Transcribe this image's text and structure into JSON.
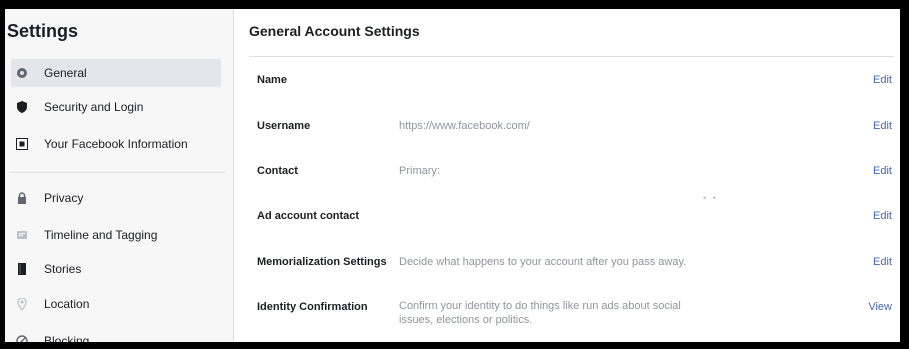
{
  "sidebar": {
    "title": "Settings",
    "items": [
      {
        "label": "General",
        "icon": "gear-icon"
      },
      {
        "label": "Security and Login",
        "icon": "shield-icon"
      },
      {
        "label": "Your Facebook Information",
        "icon": "facebook-icon"
      },
      {
        "label": "Privacy",
        "icon": "lock-icon"
      },
      {
        "label": "Timeline and Tagging",
        "icon": "tag-icon"
      },
      {
        "label": "Stories",
        "icon": "book-icon"
      },
      {
        "label": "Location",
        "icon": "location-pin-icon"
      },
      {
        "label": "Blocking",
        "icon": "block-icon"
      }
    ]
  },
  "main": {
    "title": "General Account Settings",
    "rows": [
      {
        "label": "Name",
        "value": "",
        "action": "Edit"
      },
      {
        "label": "Username",
        "value": "https://www.facebook.com/",
        "action": "Edit"
      },
      {
        "label": "Contact",
        "value": "Primary:",
        "action": "Edit"
      },
      {
        "label": "Ad account contact",
        "value": "",
        "action": "Edit"
      },
      {
        "label": "Memorialization Settings",
        "value": "Decide what happens to your account after you pass away.",
        "action": "Edit"
      },
      {
        "label": "Identity Confirmation",
        "value": "Confirm your identity to do things like run ads about social issues, elections or politics.",
        "action": "View"
      }
    ]
  },
  "colors": {
    "accent": "#4267b2",
    "sidebar_bg": "#f7f7f7",
    "active_bg": "#e5e6e9",
    "muted_text": "#90949c"
  }
}
